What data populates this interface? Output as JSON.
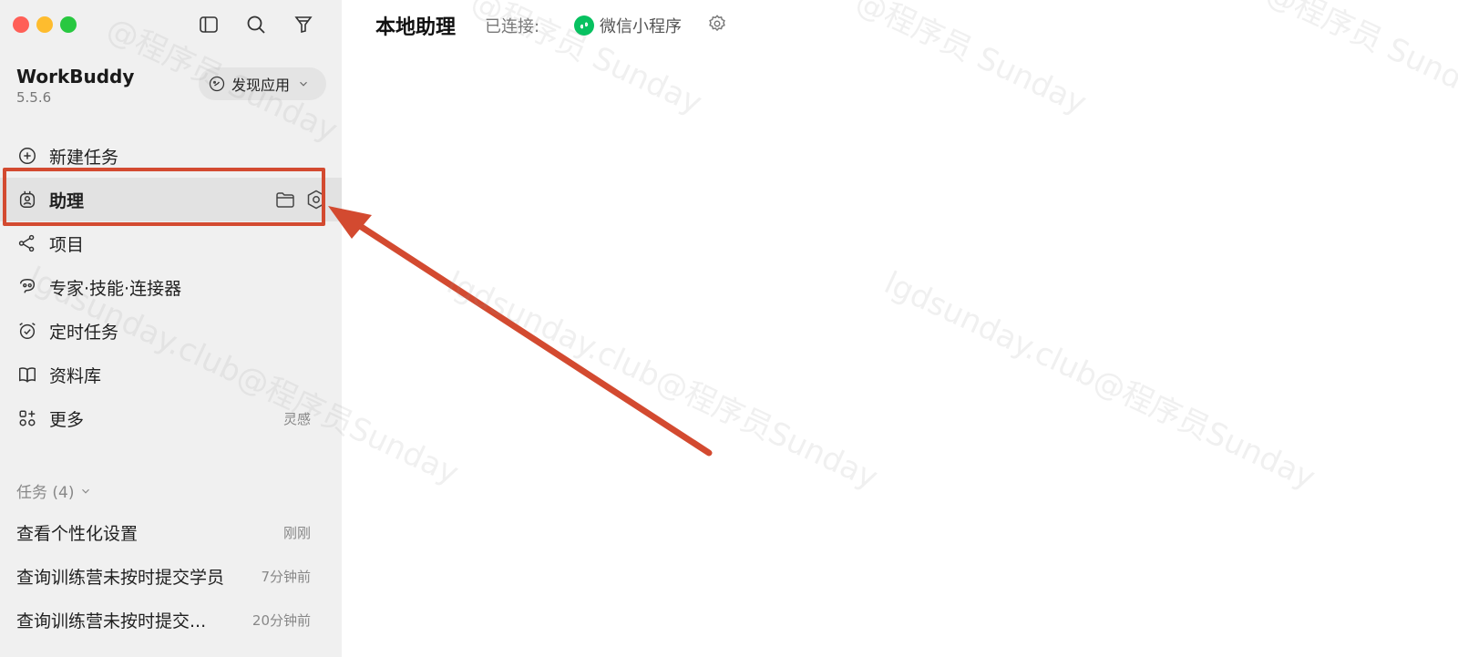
{
  "sidebar": {
    "app_name": "WorkBuddy",
    "app_version": "5.5.6",
    "discover_label": "发现应用",
    "nav": [
      {
        "label": "新建任务",
        "icon": "plus-circle-icon"
      },
      {
        "label": "助理",
        "icon": "assistant-icon",
        "active": true
      },
      {
        "label": "项目",
        "icon": "project-icon"
      },
      {
        "label": "专家·技能·连接器",
        "icon": "expert-icon"
      },
      {
        "label": "定时任务",
        "icon": "alarm-clock-icon"
      },
      {
        "label": "资料库",
        "icon": "book-icon"
      },
      {
        "label": "更多",
        "icon": "apps-icon",
        "aux": "灵感"
      }
    ],
    "tasks_header": "任务 (4)",
    "tasks": [
      {
        "title": "查看个性化设置",
        "time": "刚刚"
      },
      {
        "title": "查询训练营未按时提交学员",
        "time": "7分钟前"
      },
      {
        "title": "查询训练营未按时提交...",
        "time": "20分钟前"
      }
    ]
  },
  "header": {
    "title": "本地助理",
    "connected_label": "已连接:",
    "miniprogram_label": "微信小程序"
  },
  "watermarks": {
    "handle": "lgdsunday.club@程序员Sunday",
    "author": "@程序员 Sunday"
  },
  "colors": {
    "accent_red": "#d34a30",
    "wechat_green": "#07c160",
    "sidebar_bg": "#f0f0f0"
  }
}
